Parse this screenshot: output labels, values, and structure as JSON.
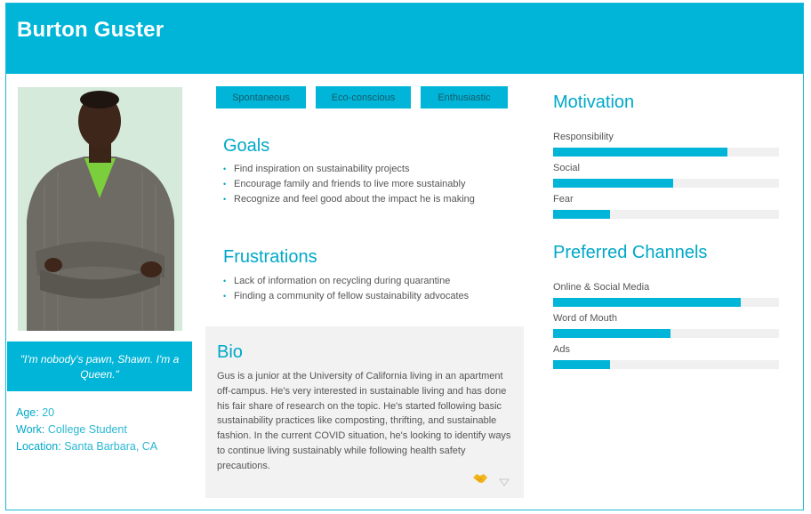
{
  "persona": {
    "name": "Burton Guster",
    "quote": "\"I'm nobody's pawn, Shawn. I'm a Queen.\"",
    "facts": [
      {
        "label": "Age:",
        "value": "20"
      },
      {
        "label": "Work:",
        "value": "College Student"
      },
      {
        "label": "Location:",
        "value": "Santa Barbara, CA"
      }
    ]
  },
  "tags": [
    "Spontaneous",
    "Eco-conscious",
    "Enthusiastic"
  ],
  "goals": {
    "title": "Goals",
    "items": [
      "Find inspiration on sustainability projects",
      "Encourage family and friends to live more sustainably",
      "Recognize and feel good about the impact he is making"
    ]
  },
  "frustrations": {
    "title": "Frustrations",
    "items": [
      "Lack of information on recycling during quarantine",
      "Finding a community of fellow sustainability advocates"
    ]
  },
  "bio": {
    "title": "Bio",
    "text": "Gus is a junior at the University of California living in an apartment off-campus. He's very interested in sustainable living and has done his fair share of research on the topic. He's started following basic sustainability practices like composting, thrifting, and sustainable fashion. In the current COVID situation, he's looking to identify ways to continue living sustainably while following health safety precautions."
  },
  "motivation": {
    "title": "Motivation",
    "bars": [
      {
        "label": "Responsibility",
        "value": 0.77
      },
      {
        "label": "Social",
        "value": 0.53
      },
      {
        "label": "Fear",
        "value": 0.25
      }
    ]
  },
  "channels": {
    "title": "Preferred Channels",
    "bars": [
      {
        "label": "Online & Social Media",
        "value": 0.83
      },
      {
        "label": "Word of Mouth",
        "value": 0.52
      },
      {
        "label": "Ads",
        "value": 0.25
      }
    ]
  },
  "colors": {
    "accent": "#00b5d8",
    "track": "#f0f0f0"
  },
  "icons": {
    "bio_icon_1": "handshake-icon",
    "bio_icon_2": "small-mark-icon"
  }
}
